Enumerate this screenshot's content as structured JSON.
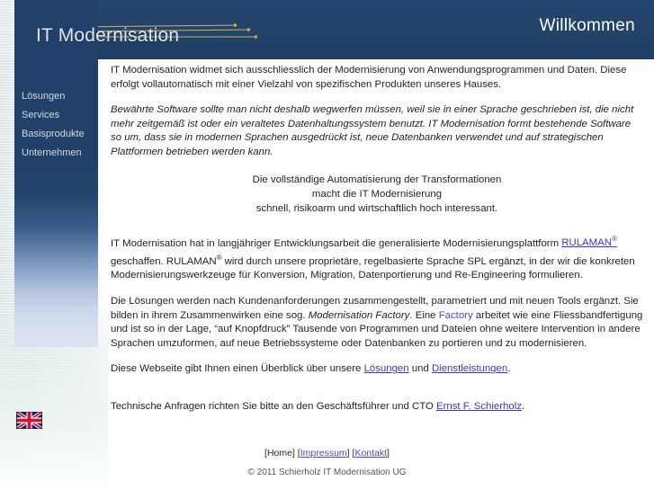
{
  "header": {
    "logo_text": "IT Modernisation",
    "title": "Willkommen"
  },
  "sidebar": {
    "items": [
      {
        "label": "Lösungen"
      },
      {
        "label": "Services"
      },
      {
        "label": "Basisprodukte"
      },
      {
        "label": "Unternehmen"
      }
    ],
    "flag_icon": "uk-flag-icon",
    "flag_alt": "English"
  },
  "main": {
    "p1": "IT Modernisation widmet sich ausschliesslich der Modernisierung von Anwendungsprogrammen und Daten. Diese erfolgt vollautomatisch mit einer Vielzahl von spezifischen Produkten unseres Hauses.",
    "p2_italic": "Bewährte Software sollte man nicht deshalb wegwerfen müssen, weil sie in einer Sprache geschrieben ist, die nicht mehr zeitgemäß ist oder ein veraltetes Datenhaltungssystem benutzt. IT Modernisation formt bestehende Software so um, dass sie in modernen Sprachen ausgedrückt ist, neue Datenbanken verwendet und auf strategischen Plattformen betrieben werden kann.",
    "center_line1": "Die vollständige Automatisierung der Transformationen",
    "center_line2": "macht die IT Modernisierung",
    "center_line3": "schnell, risikoarm und wirtschaftlich hoch interessant.",
    "p3_a": "IT Modernisation hat in langjähriger Entwicklungsarbeit die generalisierte Modernisierungsplattform ",
    "p3_link": "RULAMAN",
    "p3_link_sup": "®",
    "p3_b": " geschaffen. RULAMAN",
    "p3_sup2": "®",
    "p3_c": " wird durch unsere proprietäre, regelbasierte Sprache SPL ergänzt, in der wir die konkreten Modernisierungswerkzeuge für Konversion, Migration, Datenportierung und Re-Engineering formulieren.",
    "p4_a": "Die Lösungen werden nach Kundenanforderungen zusammengestellt, parametriert und mit neuen Tools ergänzt. Sie bilden in ihrem Zusammenwirken eine sog. ",
    "p4_italic1": "Modernisation Factory",
    "p4_b": ". Eine ",
    "p4_link": "Factory",
    "p4_c": " arbeitet wie eine Fliessbandfertigung und ist so in der Lage, “auf Knopfdruck” Tausende von Programmen und Dateien ohne weitere Intervention in andere Sprachen umzuformen, auf neue Betriebssysteme oder Datenbanken zu portieren und zu modernisieren.",
    "p5_a": "Diese Webseite gibt Ihnen einen Überblick über unsere ",
    "p5_link1": "Lösungen",
    "p5_b": " und ",
    "p5_link2": "Dienstleistungen",
    "p5_c": ".",
    "p6_a": "Technische Anfragen richten Sie bitte an den Geschäftsführer und CTO ",
    "p6_link": "Ernst F. Schierholz",
    "p6_b": "."
  },
  "footer": {
    "open_bracket": "[",
    "home": "Home",
    "sep1": "] [",
    "impressum": "Impressum",
    "sep2": "] [",
    "kontakt": "Kontakt",
    "close_bracket": "]",
    "copyright": "© 2011 Schierholz IT Modernisation UG"
  },
  "colors": {
    "header_blue": "#234469",
    "sidebar_blue": "#22416a",
    "link_blue": "#3a36c8",
    "wash_teal": "#dce9e6"
  }
}
